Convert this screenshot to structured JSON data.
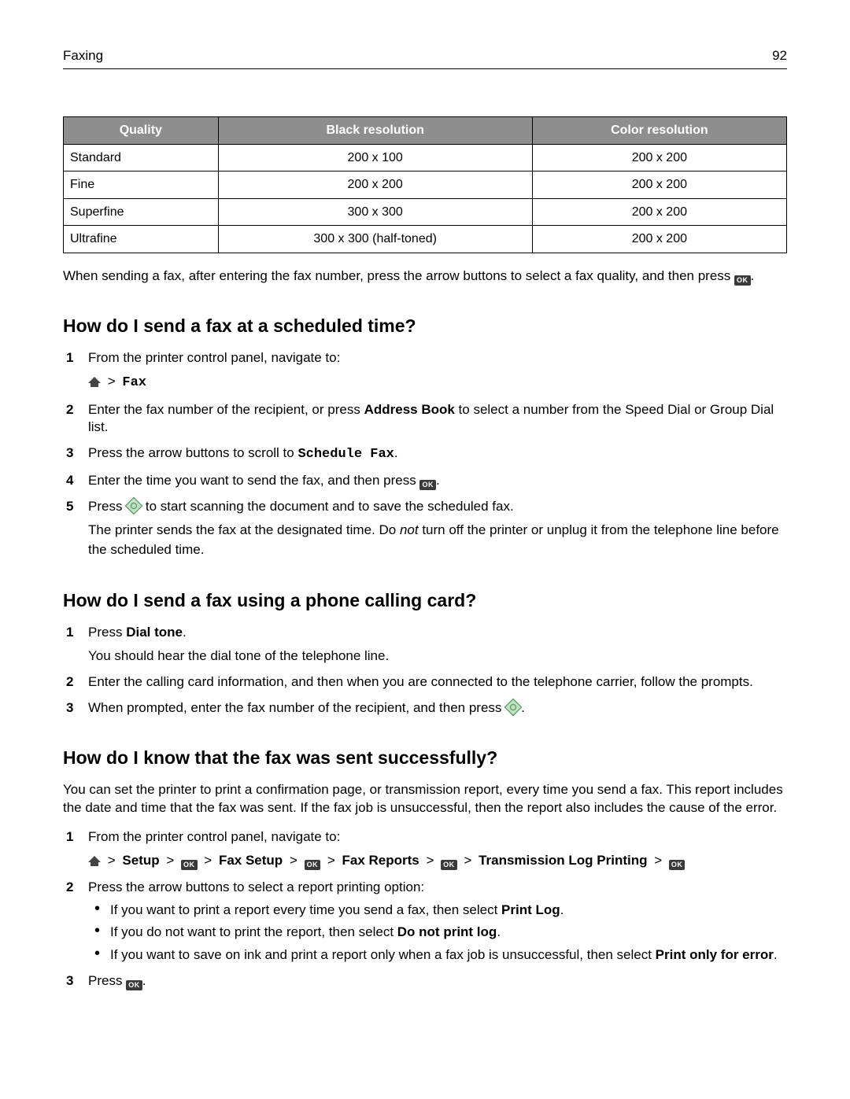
{
  "header": {
    "section": "Faxing",
    "page": "92"
  },
  "table": {
    "headers": [
      "Quality",
      "Black resolution",
      "Color resolution"
    ],
    "rows": [
      [
        "Standard",
        "200 x 100",
        "200 x 200"
      ],
      [
        "Fine",
        "200 x 200",
        "200 x 200"
      ],
      [
        "Superfine",
        "300 x 300",
        "200 x 200"
      ],
      [
        "Ultrafine",
        "300 x 300 (half-toned)",
        "200 x 200"
      ]
    ]
  },
  "para_after_table": "When sending a fax, after entering the fax number, press the arrow buttons to select a fax quality, and then press ",
  "para_after_table_end": ".",
  "h_scheduled": "How do I send a fax at a scheduled time?",
  "scheduled": {
    "s1": "From the printer control panel, navigate to:",
    "s1_nav_fax": "Fax",
    "s2_a": "Enter the fax number of the recipient, or press ",
    "s2_bold": "Address Book",
    "s2_b": " to select a number from the Speed Dial or Group Dial list.",
    "s3_a": "Press the arrow buttons to scroll to ",
    "s3_mono": "Schedule Fax",
    "s3_b": ".",
    "s4_a": "Enter the time you want to send the fax, and then press ",
    "s4_b": ".",
    "s5_a": "Press ",
    "s5_b": " to start scanning the document and to save the scheduled fax.",
    "s5_note_a": "The printer sends the fax at the designated time. Do ",
    "s5_note_i": "not",
    "s5_note_b": " turn off the printer or unplug it from the telephone line before the scheduled time."
  },
  "h_calling": "How do I send a fax using a phone calling card?",
  "calling": {
    "s1_a": "Press ",
    "s1_bold": "Dial tone",
    "s1_b": ".",
    "s1_note": "You should hear the dial tone of the telephone line.",
    "s2": "Enter the calling card information, and then when you are connected to the telephone carrier, follow the prompts.",
    "s3_a": "When prompted, enter the fax number of the recipient, and then press ",
    "s3_b": "."
  },
  "h_success": "How do I know that the fax was sent successfully?",
  "success": {
    "intro": "You can set the printer to print a confirmation page, or transmission report, every time you send a fax. This report includes the date and time that the fax was sent. If the fax job is unsuccessful, then the report also includes the cause of the error.",
    "s1": "From the printer control panel, navigate to:",
    "nav": {
      "setup": "Setup",
      "fax_setup": "Fax Setup",
      "fax_reports": "Fax Reports",
      "tx_log": "Transmission Log Printing",
      "sep": ">"
    },
    "s2": "Press the arrow buttons to select a report printing option:",
    "b1_a": "If you want to print a report every time you send a fax, then select ",
    "b1_bold": "Print Log",
    "b1_b": ".",
    "b2_a": "If you do not want to print the report, then select ",
    "b2_bold": "Do not print log",
    "b2_b": ".",
    "b3_a": "If you want to save on ink and print a report only when a fax job is unsuccessful, then select ",
    "b3_bold": "Print only for error",
    "b3_b": ".",
    "s3_a": "Press ",
    "s3_b": "."
  },
  "icons": {
    "ok_label": "OK"
  }
}
